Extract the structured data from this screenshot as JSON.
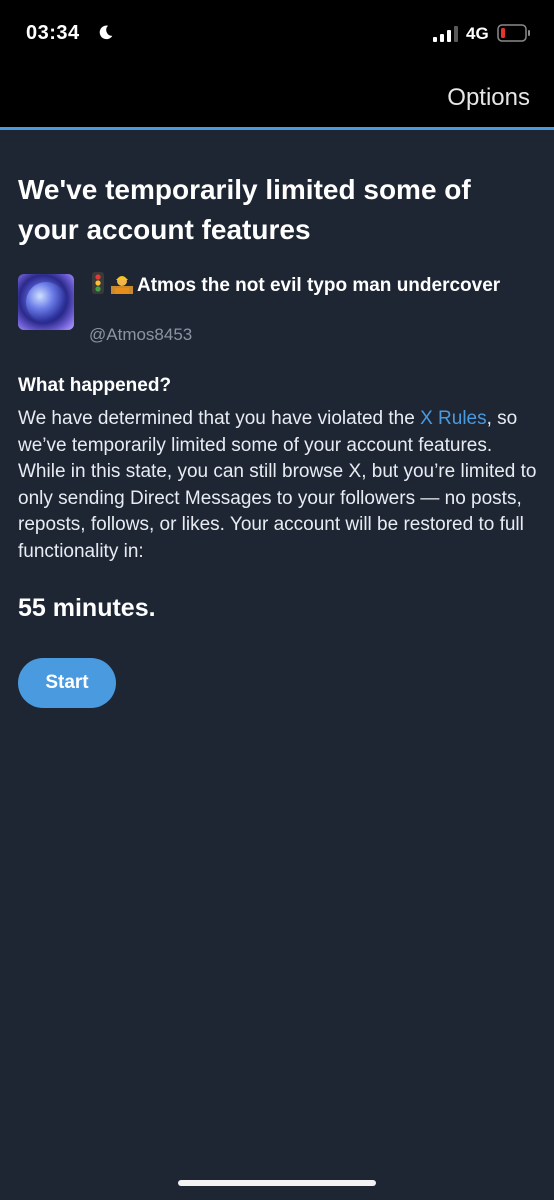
{
  "status_bar": {
    "time": "03:34",
    "network": "4G",
    "icons": [
      "moon-icon",
      "signal-icon",
      "battery-low-icon"
    ],
    "battery_color": "#e5342b"
  },
  "header": {
    "options_label": "Options"
  },
  "page": {
    "title": "We've temporarily limited some of your account features",
    "user": {
      "emojis": [
        "traffic-light-emoji",
        "construction-worker-emoji"
      ],
      "display_name": "Atmos the not evil typo man undercover",
      "handle": "@Atmos8453"
    },
    "section_heading": "What happened?",
    "body_before_link": "We have determined that you have violated the ",
    "body_link": "X Rules",
    "body_after_link": ", so we’ve temporarily limited some of your account features. While in this state, you can still browse X, but you’re limited to only sending Direct Messages to your followers — no posts, reposts, follows, or likes. Your account will be restored to full functionality in:",
    "duration": "55 minutes.",
    "start_button_label": "Start"
  },
  "colors": {
    "accent": "#4a9ae0",
    "background": "#1e2634",
    "bar_background": "#000000",
    "muted_text": "#8a94a3"
  }
}
